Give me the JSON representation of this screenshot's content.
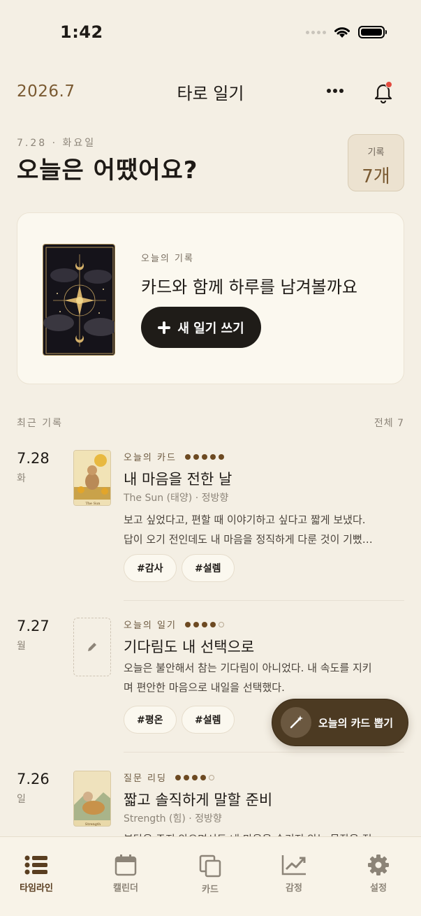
{
  "status": {
    "time": "1:42"
  },
  "header": {
    "month": "2026.7",
    "title": "타로 일기"
  },
  "today": {
    "date": "7.28 · 화요일",
    "greeting": "오늘은 어땠어요?",
    "count_label": "기록",
    "count_value": "7개"
  },
  "hero": {
    "subtitle": "오늘의 기록",
    "text": "카드와 함께 하루를 남겨볼까요",
    "button": "새 일기 쓰기"
  },
  "recent": {
    "label": "최근 기록",
    "total": "전체 7"
  },
  "entries": [
    {
      "date": "7.28",
      "dow": "화",
      "tag": "오늘의 카드",
      "rating": 5,
      "title": "내 마음을 전한 날",
      "card": "The Sun (태양) · 정방향",
      "body": [
        "보고 싶었다고, 편할 때 이야기하고 싶다고 짧게 보냈다.",
        "답이 오기 전인데도 내 마음을 정직하게 다룬 것이 기뻤…"
      ],
      "tags": [
        "#감사",
        "#설렘"
      ],
      "thumb_caption": "The Sun"
    },
    {
      "date": "7.27",
      "dow": "월",
      "tag": "오늘의 일기",
      "rating": 4,
      "title": "기다림도 내 선택으로",
      "card": "",
      "body": [
        "오늘은 불안해서 참는 기다림이 아니었다. 내 속도를 지키",
        "며 편안한 마음으로 내일을 선택했다."
      ],
      "tags": [
        "#평온",
        "#설렘"
      ]
    },
    {
      "date": "7.26",
      "dow": "일",
      "tag": "질문 리딩",
      "rating": 4,
      "title": "짧고 솔직하게 말할 준비",
      "card": "Strength (힘) · 정방향",
      "body": [
        "부담은 주지 않으면서도 내 마음을 숨기지 않는 문장을 적"
      ],
      "tags": [],
      "thumb_caption": "Strength"
    }
  ],
  "fab": {
    "label": "오늘의 카드 뽑기"
  },
  "tabs": [
    {
      "label": "타임라인",
      "icon": "list-icon",
      "active": true
    },
    {
      "label": "캘린더",
      "icon": "calendar-icon"
    },
    {
      "label": "카드",
      "icon": "cards-icon"
    },
    {
      "label": "감정",
      "icon": "chart-icon"
    },
    {
      "label": "설정",
      "icon": "gear-icon"
    }
  ],
  "colors": {
    "background": "#f4efe4",
    "accent": "#7a5a32",
    "dark": "#1f1c18",
    "fab": "#4c3a22"
  }
}
